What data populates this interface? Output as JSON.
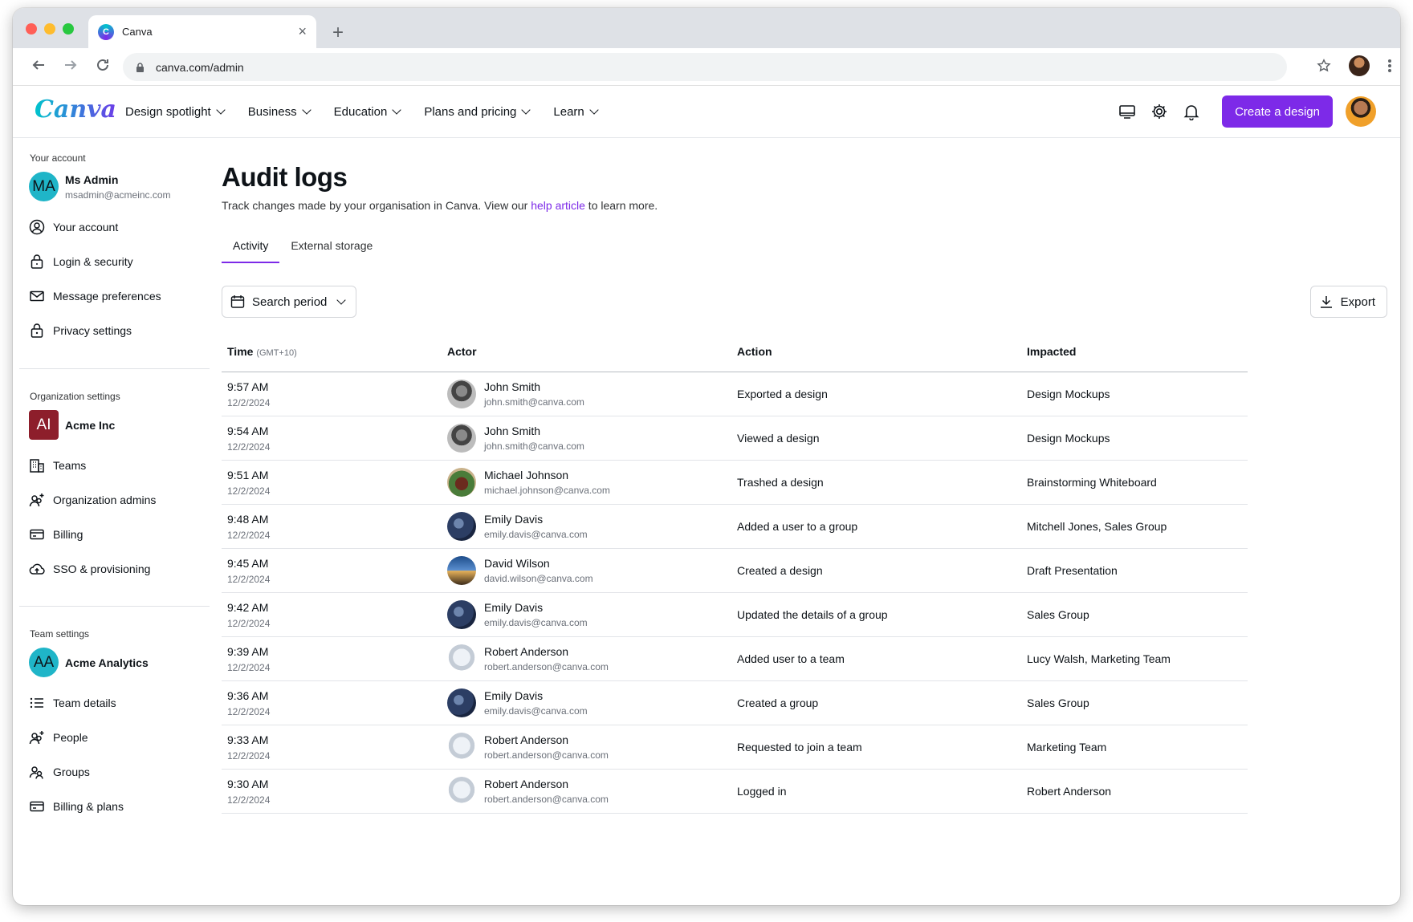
{
  "browser": {
    "tab_title": "Canva",
    "url": "canva.com/admin"
  },
  "header": {
    "logo": "Canva",
    "nav": [
      "Design spotlight",
      "Business",
      "Education",
      "Plans and pricing",
      "Learn"
    ],
    "create_button": "Create a design"
  },
  "sidebar": {
    "account": {
      "heading": "Your account",
      "initials": "MA",
      "name": "Ms Admin",
      "email": "msadmin@acmeinc.com",
      "items": [
        "Your account",
        "Login & security",
        "Message preferences",
        "Privacy settings"
      ]
    },
    "organization": {
      "heading": "Organization settings",
      "initials": "AI",
      "name": "Acme Inc",
      "items": [
        "Teams",
        "Organization admins",
        "Billing",
        "SSO & provisioning"
      ]
    },
    "team": {
      "heading": "Team settings",
      "initials": "AA",
      "name": "Acme Analytics",
      "items": [
        "Team details",
        "People",
        "Groups",
        "Billing & plans"
      ]
    }
  },
  "main": {
    "title": "Audit logs",
    "subtitle_before": "Track changes made by your organisation in Canva. View our ",
    "subtitle_link": "help article",
    "subtitle_after": " to learn more.",
    "tabs": [
      "Activity",
      "External storage"
    ],
    "search_period": "Search period",
    "export": "Export",
    "columns": {
      "time": "Time",
      "timezone": "(GMT+10)",
      "actor": "Actor",
      "action": "Action",
      "impacted": "Impacted"
    },
    "rows": [
      {
        "time": "9:57 AM",
        "date": "12/2/2024",
        "actor": "John Smith",
        "email": "john.smith@canva.com",
        "action": "Exported a design",
        "impacted": "Design Mockups"
      },
      {
        "time": "9:54 AM",
        "date": "12/2/2024",
        "actor": "John Smith",
        "email": "john.smith@canva.com",
        "action": "Viewed a design",
        "impacted": "Design Mockups"
      },
      {
        "time": "9:51 AM",
        "date": "12/2/2024",
        "actor": "Michael Johnson",
        "email": "michael.johnson@canva.com",
        "action": "Trashed a design",
        "impacted": "Brainstorming Whiteboard"
      },
      {
        "time": "9:48 AM",
        "date": "12/2/2024",
        "actor": "Emily Davis",
        "email": "emily.davis@canva.com",
        "action": "Added a user to a group",
        "impacted": "Mitchell Jones, Sales Group"
      },
      {
        "time": "9:45 AM",
        "date": "12/2/2024",
        "actor": "David Wilson",
        "email": "david.wilson@canva.com",
        "action": "Created a design",
        "impacted": "Draft Presentation"
      },
      {
        "time": "9:42 AM",
        "date": "12/2/2024",
        "actor": "Emily Davis",
        "email": "emily.davis@canva.com",
        "action": "Updated the details of a group",
        "impacted": "Sales Group"
      },
      {
        "time": "9:39 AM",
        "date": "12/2/2024",
        "actor": "Robert Anderson",
        "email": "robert.anderson@canva.com",
        "action": "Added user to a team",
        "impacted": "Lucy Walsh, Marketing Team"
      },
      {
        "time": "9:36 AM",
        "date": "12/2/2024",
        "actor": "Emily Davis",
        "email": "emily.davis@canva.com",
        "action": "Created a group",
        "impacted": "Sales Group"
      },
      {
        "time": "9:33 AM",
        "date": "12/2/2024",
        "actor": "Robert Anderson",
        "email": "robert.anderson@canva.com",
        "action": "Requested to join a team",
        "impacted": "Marketing Team"
      },
      {
        "time": "9:30 AM",
        "date": "12/2/2024",
        "actor": "Robert Anderson",
        "email": "robert.anderson@canva.com",
        "action": "Logged in",
        "impacted": "Robert Anderson"
      }
    ]
  },
  "colors": {
    "accent": "#7d2ae8",
    "org_avatar": "#8d1e2b",
    "user_avatar_teal": "#1fb5c8"
  }
}
